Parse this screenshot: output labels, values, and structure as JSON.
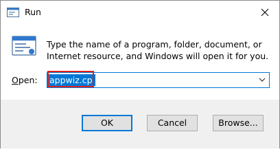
{
  "window": {
    "title": "Run"
  },
  "description": "Type the name of a program, folder, document, or Internet resource, and Windows will open it for you.",
  "open": {
    "label_accel": "O",
    "label_rest": "pen:",
    "value": "appwiz.cpl"
  },
  "buttons": {
    "ok": "OK",
    "cancel": "Cancel",
    "browse": "Browse..."
  },
  "colors": {
    "accent": "#0078d7",
    "highlight": "#e0201c",
    "footer": "#f0f0f0"
  },
  "icons": {
    "app": "run-app-icon",
    "close": "close-icon",
    "run": "run-icon",
    "dropdown": "chevron-down-icon"
  }
}
